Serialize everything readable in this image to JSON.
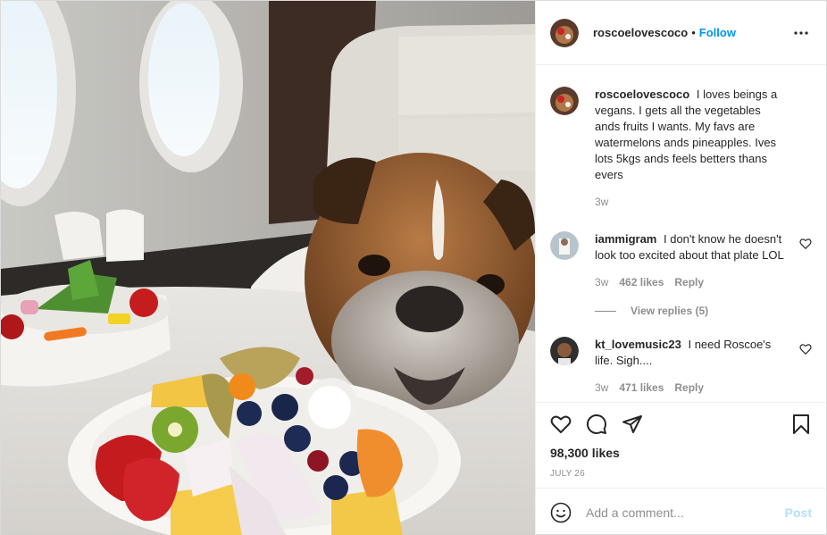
{
  "post": {
    "image_alt": "Bulldog resting its chin on a table with a plate of fruit and a bowl of vegetables inside a private jet",
    "username": "roscoelovescoco",
    "dot": "•",
    "follow_label": "Follow",
    "more_icon": "more-horizontal-icon"
  },
  "caption": {
    "username": "roscoelovescoco",
    "text": "I loves beings a vegans. I gets all the vegetables ands fruits I wants. My favs are watermelons ands pineapples. Ives lots 5kgs ands feels betters thans evers",
    "time": "3w"
  },
  "comments": [
    {
      "username": "iammigram",
      "text": "I don't know he doesn't look too excited about that plate LOL",
      "time": "3w",
      "likes": "462 likes",
      "reply_label": "Reply",
      "view_replies": "View replies (5)"
    },
    {
      "username": "kt_lovemusic23",
      "text": "I need Roscoe's life. Sigh....",
      "time": "3w",
      "likes": "471 likes",
      "reply_label": "Reply"
    }
  ],
  "actions": {
    "like_icon": "heart-icon",
    "comment_icon": "comment-icon",
    "share_icon": "share-icon",
    "save_icon": "bookmark-icon"
  },
  "likes_count": "98,300 likes",
  "date": "JULY 26",
  "add_comment": {
    "placeholder": "Add a comment...",
    "post_label": "Post",
    "emoji_icon": "emoji-icon"
  },
  "colors": {
    "accent": "#0095f6",
    "post_disabled": "#b2dffc",
    "muted": "#8e8e8e",
    "text": "#262626"
  }
}
